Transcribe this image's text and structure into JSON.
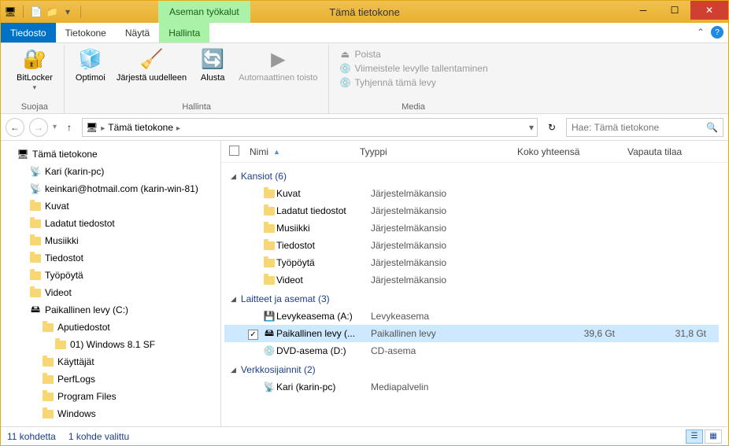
{
  "title": "Tämä tietokone",
  "tool_tab": "Aseman työkalut",
  "tabs": {
    "file": "Tiedosto",
    "computer": "Tietokone",
    "view": "Näytä",
    "manage": "Hallinta"
  },
  "ribbon": {
    "protect": {
      "bitlocker": "BitLocker",
      "title": "Suojaa"
    },
    "manage": {
      "optimize": "Optimoi",
      "reorder": "Järjestä uudelleen",
      "format": "Alusta",
      "autoplay": "Automaattinen toisto",
      "title": "Hallinta"
    },
    "media": {
      "delete": "Poista",
      "finalize": "Viimeistele levylle tallentaminen",
      "erase": "Tyhjennä tämä levy",
      "title": "Media"
    }
  },
  "nav": {
    "crumb": "Tämä tietokone"
  },
  "search": {
    "placeholder": "Hae: Tämä tietokone"
  },
  "columns": {
    "name": "Nimi",
    "type": "Tyyppi",
    "size": "Koko yhteensä",
    "free": "Vapauta tilaa"
  },
  "tree": [
    {
      "label": "Tämä tietokone",
      "icon": "pc",
      "indent": 1
    },
    {
      "label": "Kari (karin-pc)",
      "icon": "net",
      "indent": 2
    },
    {
      "label": "keinkari@hotmail.com (karin-win-81)",
      "icon": "net",
      "indent": 2
    },
    {
      "label": "Kuvat",
      "icon": "folder",
      "indent": 2
    },
    {
      "label": "Ladatut tiedostot",
      "icon": "folder",
      "indent": 2
    },
    {
      "label": "Musiikki",
      "icon": "folder",
      "indent": 2
    },
    {
      "label": "Tiedostot",
      "icon": "folder",
      "indent": 2
    },
    {
      "label": "Työpöytä",
      "icon": "folder",
      "indent": 2
    },
    {
      "label": "Videot",
      "icon": "folder",
      "indent": 2
    },
    {
      "label": "Paikallinen levy (C:)",
      "icon": "drive",
      "indent": 2
    },
    {
      "label": "Aputiedostot",
      "icon": "folder",
      "indent": 3
    },
    {
      "label": "01) Windows 8.1 SF",
      "icon": "folder",
      "indent": 4
    },
    {
      "label": "Käyttäjät",
      "icon": "folder",
      "indent": 3
    },
    {
      "label": "PerfLogs",
      "icon": "folder",
      "indent": 3
    },
    {
      "label": "Program Files",
      "icon": "folder",
      "indent": 3
    },
    {
      "label": "Windows",
      "icon": "folder",
      "indent": 3
    }
  ],
  "groups": [
    {
      "title": "Kansiot (6)",
      "rows": [
        {
          "name": "Kuvat",
          "type": "Järjestelmäkansio"
        },
        {
          "name": "Ladatut tiedostot",
          "type": "Järjestelmäkansio"
        },
        {
          "name": "Musiikki",
          "type": "Järjestelmäkansio"
        },
        {
          "name": "Tiedostot",
          "type": "Järjestelmäkansio"
        },
        {
          "name": "Työpöytä",
          "type": "Järjestelmäkansio"
        },
        {
          "name": "Videot",
          "type": "Järjestelmäkansio"
        }
      ]
    },
    {
      "title": "Laitteet ja asemat (3)",
      "rows": [
        {
          "name": "Levykeasema (A:)",
          "type": "Levykeasema",
          "icon": "floppy"
        },
        {
          "name": "Paikallinen levy (...",
          "type": "Paikallinen levy",
          "size": "39,6 Gt",
          "free": "31,8 Gt",
          "icon": "drive",
          "selected": true
        },
        {
          "name": "DVD-asema (D:)",
          "type": "CD-asema",
          "icon": "dvd"
        }
      ]
    },
    {
      "title": "Verkkosijainnit (2)",
      "rows": [
        {
          "name": "Kari (karin-pc)",
          "type": "Mediapalvelin",
          "icon": "net"
        }
      ]
    }
  ],
  "status": {
    "count": "11 kohdetta",
    "selected": "1 kohde valittu"
  }
}
